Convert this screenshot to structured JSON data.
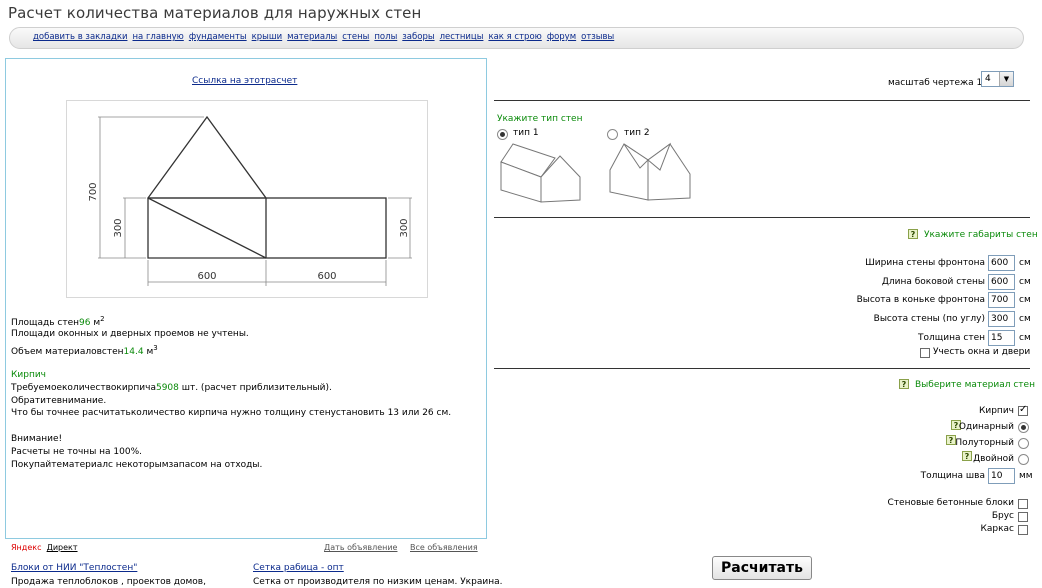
{
  "page_title": "Расчет количества материалов для наружных стен",
  "nav": [
    "добавить в закладки",
    "на главную",
    "фундаменты",
    "крыши",
    "материалы",
    "стены",
    "полы",
    "заборы",
    "лестницы",
    "как я строю",
    "форум",
    "отзывы"
  ],
  "left": {
    "calc_link": "Ссылка на этотрасчет",
    "drawing": {
      "dim_700": "700",
      "dim_300_left": "300",
      "dim_300_right": "300",
      "dim_600_a": "600",
      "dim_600_b": "600"
    },
    "area_label": "Площадь  стен",
    "area_value": "96",
    "area_unit": "м",
    "area_sup": "2",
    "area_note": "Площади оконных и дверных проемов не учтены.",
    "volume_label": "Объем материаловстен",
    "volume_value": "14.4",
    "volume_unit": "м",
    "volume_sup": "3",
    "brick_heading": "Кирпич",
    "brick_req_prefix": "Требуемоеколичествокирпича",
    "brick_req_value": "5908",
    "brick_req_suffix": " шт. (расчет приблизительный).",
    "note_heading": "Обратитевнимание.",
    "note_text": "Что бы точнее расчитатьколичество кирпича нужно толщину  стенустановить 13 или 26 см.",
    "warn_heading": "Внимание!",
    "warn_line1": "Расчеты не точны на 100%.",
    "warn_line2": "Покупайтематериалс некоторымзапасом на отходы."
  },
  "ads": {
    "yandex": "Яндекс",
    "direct": "Директ",
    "give_ad": "Дать объявление",
    "all_ads": "Все объявления",
    "ad1_title": "Блоки от НИИ \"Теплостен\"",
    "ad1_text": "Продажа теплоблоков , проектов домов,",
    "ad2_title": "Сетка рабица - опт",
    "ad2_text": "Сетка от производителя по низким ценам. Украина."
  },
  "right": {
    "scale_label": "масштаб чертежа 1 :",
    "scale_value": "4",
    "wall_type_heading": "Укажите тип стен",
    "type1": "тип 1",
    "type2": "тип 2",
    "dims_heading": "Укажите габариты стен",
    "fields": [
      {
        "label": "Ширина стены фронтона",
        "value": "600",
        "unit": "см"
      },
      {
        "label": "Длина боковой стены",
        "value": "600",
        "unit": "см"
      },
      {
        "label": "Высота в коньке фронтона",
        "value": "700",
        "unit": "см"
      },
      {
        "label": "Высота стены (по углу)",
        "value": "300",
        "unit": "см"
      },
      {
        "label": "Толщина стен",
        "value": "15",
        "unit": "см"
      }
    ],
    "openings_label": "Учесть окна и двери",
    "material_heading": "Выберите материал стен",
    "brick_label": "Кирпич",
    "single": "Одинарный",
    "one_half": "Полуторный",
    "double": "Двойной",
    "seam_label": "Толщина шва",
    "seam_value": "10",
    "seam_unit": "мм",
    "concrete_blocks": "Стеновые бетонные блоки",
    "timber": "Брус",
    "frame": "Каркас",
    "calc_button": "Расчитать"
  }
}
